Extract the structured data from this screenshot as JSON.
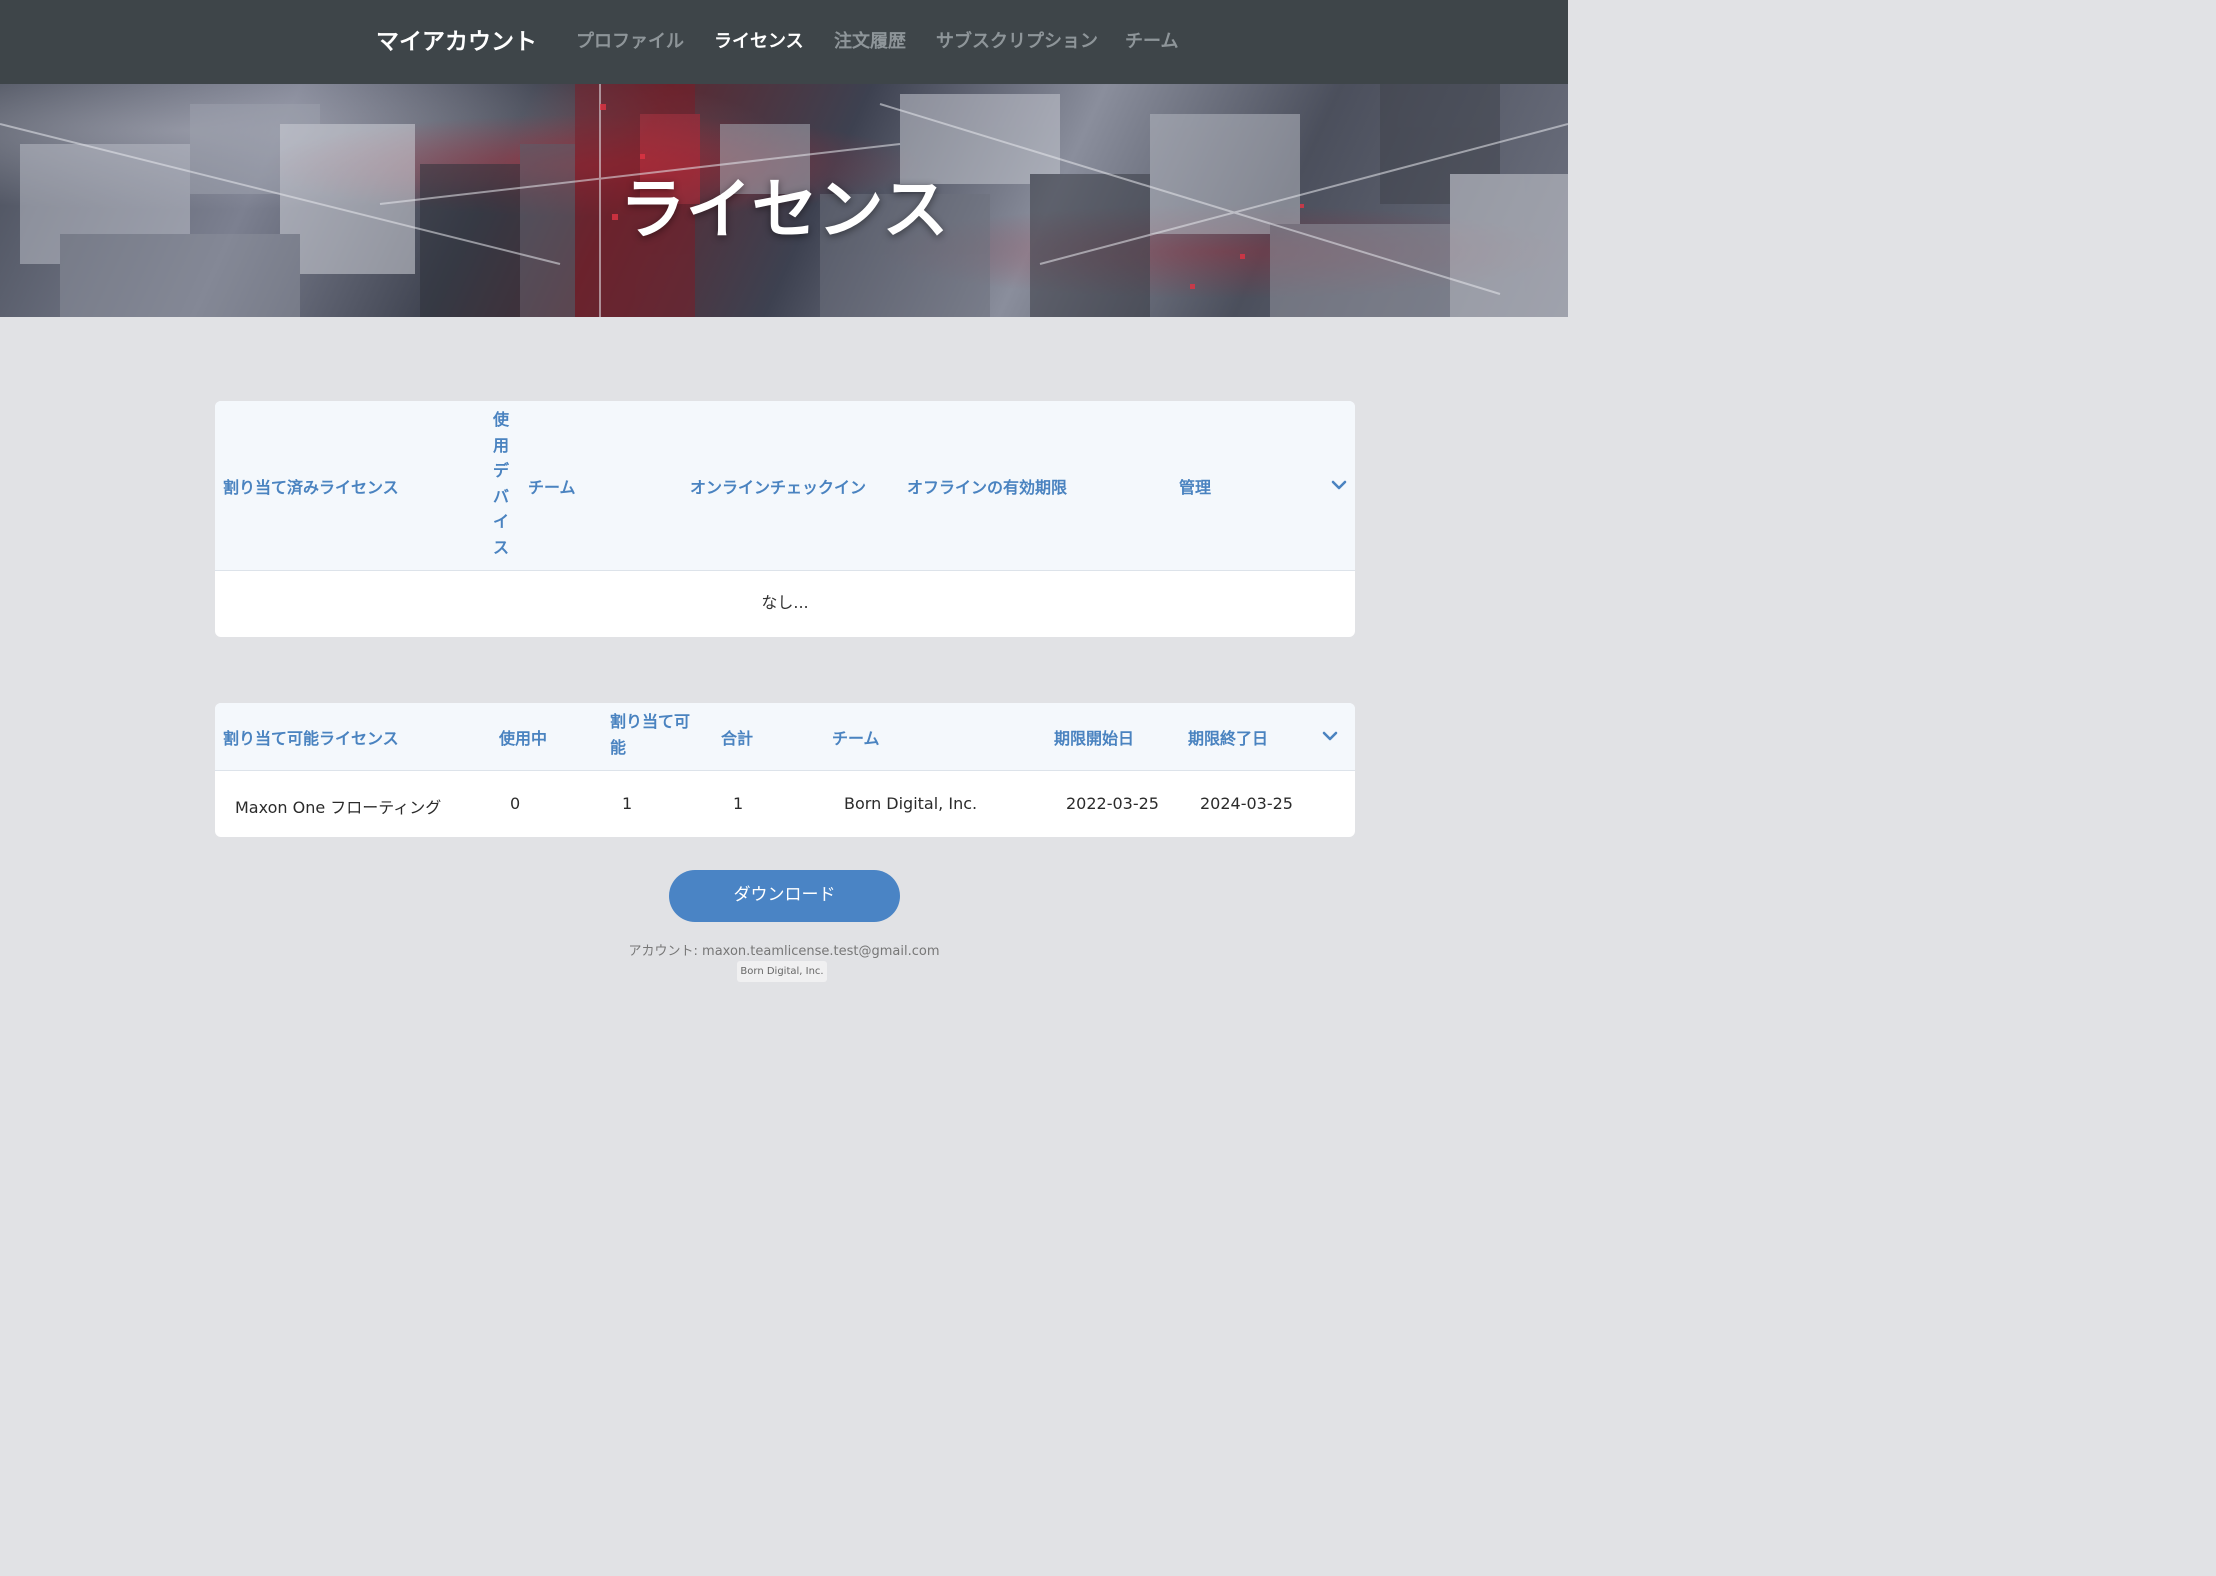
{
  "nav": {
    "brand": "マイアカウント",
    "items": [
      {
        "label": "プロファイル",
        "active": false
      },
      {
        "label": "ライセンス",
        "active": true
      },
      {
        "label": "注文履歴",
        "active": false
      },
      {
        "label": "サブスクリプション",
        "active": false
      },
      {
        "label": "チーム",
        "active": false
      }
    ]
  },
  "hero": {
    "title": "ライセンス"
  },
  "assigned_table": {
    "headers": {
      "license": "割り当て済みライセンス",
      "devices": "使用デバイス",
      "team": "チーム",
      "online_checkin": "オンラインチェックイン",
      "offline_expiry": "オフラインの有効期限",
      "manage": "管理"
    },
    "empty_text": "なし..."
  },
  "assignable_table": {
    "headers": {
      "license": "割り当て可能ライセンス",
      "in_use": "使用中",
      "assignable": "割り当て可能",
      "total": "合計",
      "team": "チーム",
      "start_date": "期限開始日",
      "end_date": "期限終了日"
    },
    "rows": [
      {
        "license": "Maxon One フローティング",
        "in_use": "0",
        "assignable": "1",
        "total": "1",
        "team": "Born Digital, Inc.",
        "start_date": "2022-03-25",
        "end_date": "2024-03-25"
      }
    ]
  },
  "download_button": "ダウンロード",
  "account": {
    "line": "アカウント: maxon.teamlicense.test@gmail.com",
    "org": "Born Digital, Inc."
  },
  "colors": {
    "nav_bg": "#3e4549",
    "page_bg": "#e1e2e5",
    "accent": "#4a84c5",
    "header_text": "#4a83c0"
  }
}
